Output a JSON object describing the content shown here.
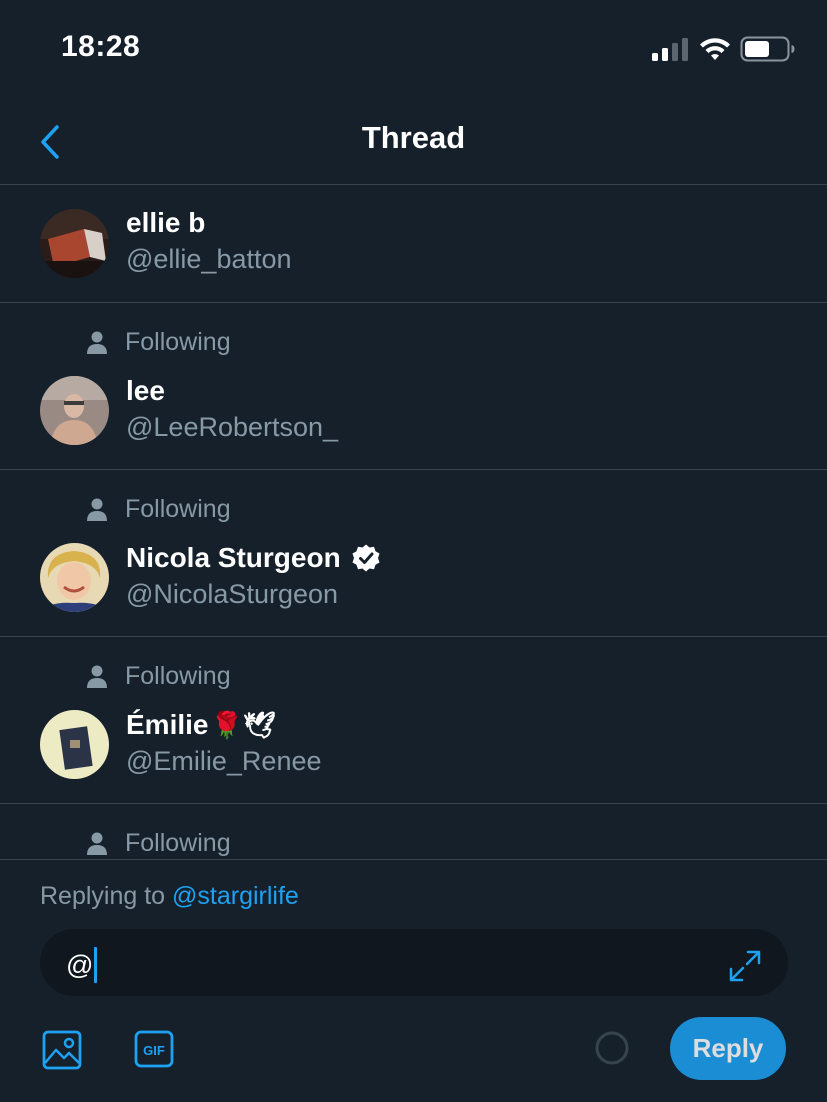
{
  "status_bar": {
    "time": "18:28"
  },
  "nav": {
    "title": "Thread",
    "back_icon": "chevron-left-icon"
  },
  "users": [
    {
      "display_name": "ellie b",
      "handle": "@ellie_batton",
      "social_context": "",
      "verified": false
    },
    {
      "display_name": "lee",
      "handle": "@LeeRobertson_",
      "social_context": "Following",
      "verified": false
    },
    {
      "display_name": "Nicola Sturgeon",
      "handle": "@NicolaSturgeon",
      "social_context": "Following",
      "verified": true
    },
    {
      "display_name": "Émilie",
      "emoji": "🌹🕊",
      "handle": "@Emilie_Renee",
      "social_context": "Following",
      "verified": false
    },
    {
      "display_name": "",
      "handle": "",
      "social_context": "Following",
      "verified": false
    }
  ],
  "composer": {
    "replying_prefix": "Replying to",
    "replying_mention": "@stargirlife",
    "input_value": "@",
    "reply_label": "Reply",
    "gif_label": "GIF"
  },
  "colors": {
    "background": "#15202b",
    "accent": "#1da1f2",
    "secondary_text": "#8899a6",
    "divider": "#38444d"
  }
}
